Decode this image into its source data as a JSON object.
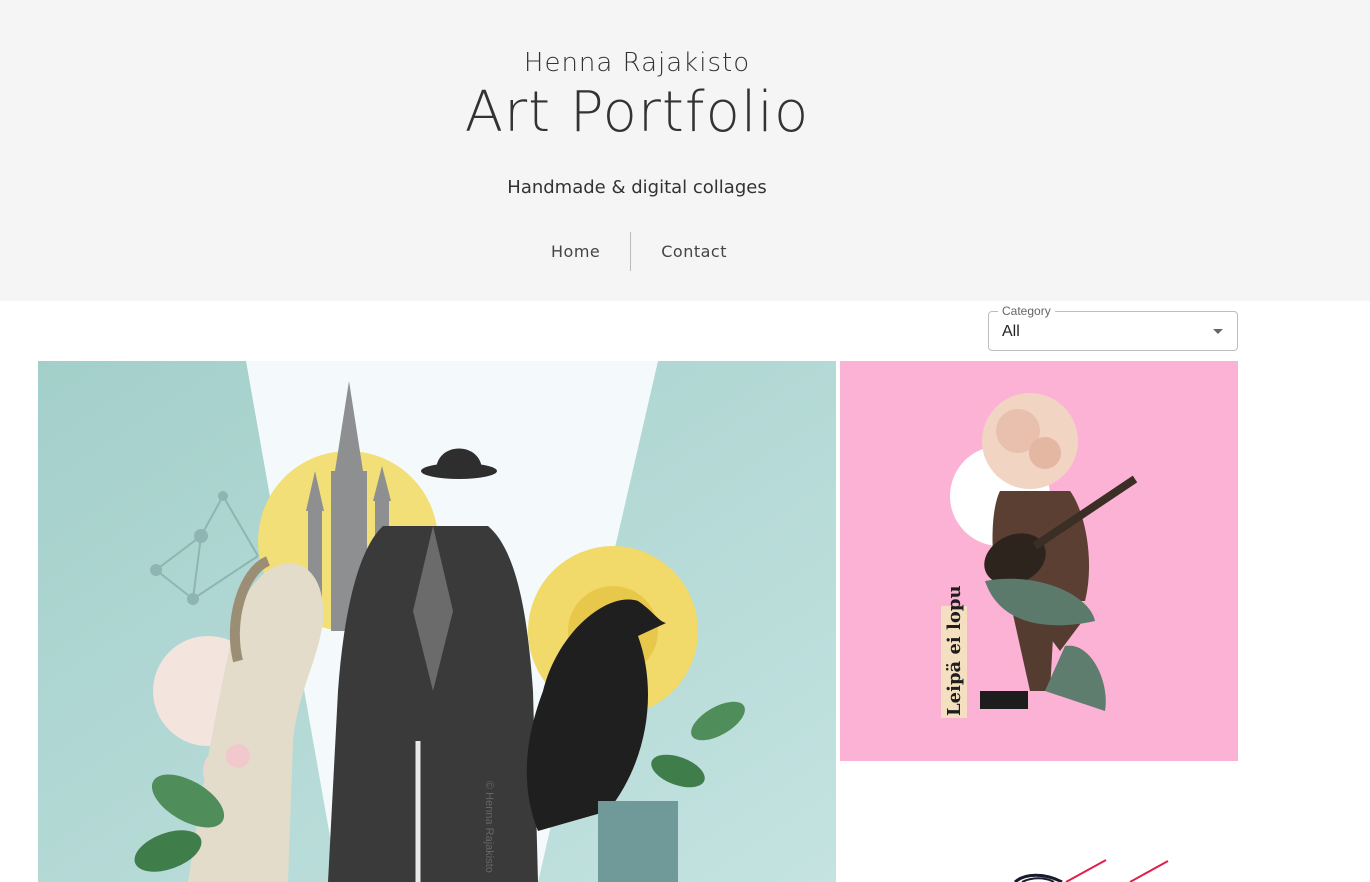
{
  "header": {
    "artist": "Henna Rajakisto",
    "title": "Art Portfolio",
    "tagline": "Handmade & digital collages"
  },
  "nav": {
    "items": [
      {
        "label": "Home"
      },
      {
        "label": "Contact"
      }
    ]
  },
  "filter": {
    "label": "Category",
    "value": "All"
  },
  "gallery": {
    "artworks": [
      {
        "subject": "dapper-collage",
        "signature": "© Henna Rajakisto"
      },
      {
        "subject": "rose-guitarist-collage",
        "caption": "Leipä ei lopu"
      },
      {
        "subject": "geometric-collage"
      }
    ]
  },
  "colors": {
    "header_bg": "#f5f5f5",
    "teal": "#a9d4d0",
    "pink": "#fbb2d4",
    "yellow": "#f3df78"
  }
}
